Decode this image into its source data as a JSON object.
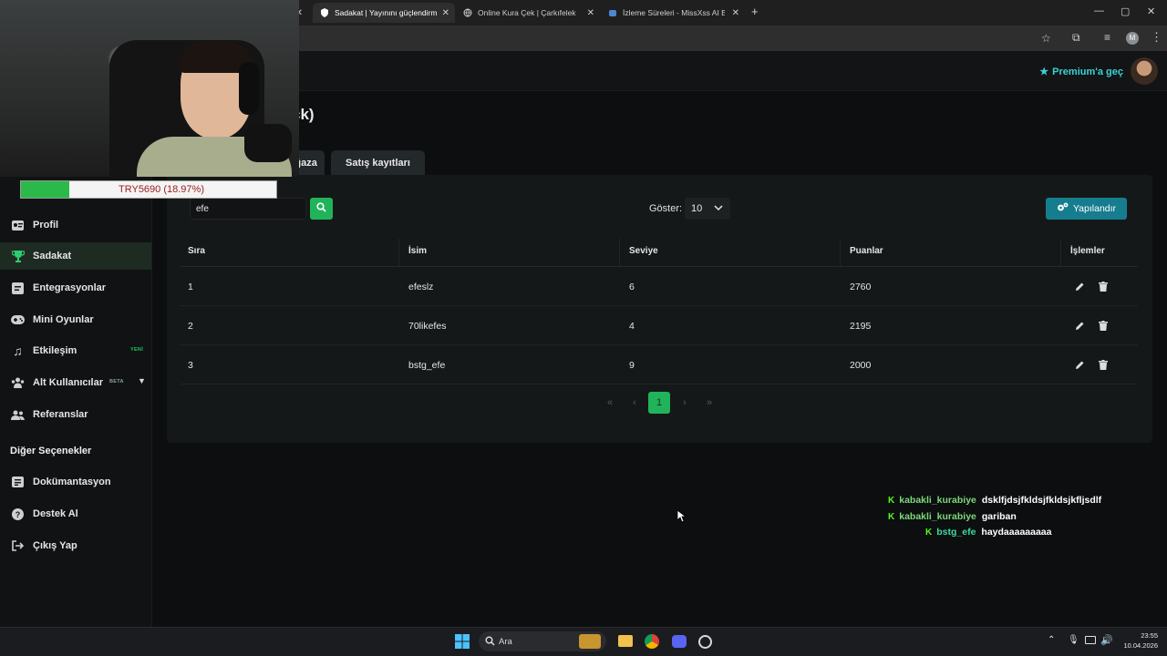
{
  "browser": {
    "tabs": [
      {
        "title": "Sadakat | Yayınını güçlendirmek",
        "active": true
      },
      {
        "title": "Online Kura Çek | Çarkıfelek",
        "active": false
      },
      {
        "title": "İzleme Süreleri - MissXss AI Bot",
        "active": false
      }
    ],
    "new_tab": "+",
    "profile_initial": "M"
  },
  "header": {
    "premium_label": "Premium'a geç"
  },
  "sidebar": {
    "items": [
      {
        "label": "Profil",
        "icon": "id-card-icon",
        "active": false
      },
      {
        "label": "Sadakat",
        "icon": "trophy-icon",
        "active": true
      },
      {
        "label": "Entegrasyonlar",
        "icon": "plugin-icon",
        "active": false
      },
      {
        "label": "Mini Oyunlar",
        "icon": "gamepad-icon",
        "active": false
      },
      {
        "label": "Etkileşim",
        "icon": "music-icon",
        "active": false,
        "badge": "YENİ",
        "badge_color": "#21c45d"
      },
      {
        "label": "Alt Kullanıcılar",
        "icon": "users-icon",
        "active": false,
        "badge": "BETA",
        "badge_color": "#8aa0a8"
      },
      {
        "label": "Referanslar",
        "icon": "handshake-icon",
        "active": false
      }
    ],
    "other_title": "Diğer Seçenekler",
    "other_items": [
      {
        "label": "Dokümantasyon",
        "icon": "doc-icon"
      },
      {
        "label": "Destek Al",
        "icon": "help-icon"
      },
      {
        "label": "Çıkış Yap",
        "icon": "logout-icon"
      }
    ]
  },
  "main": {
    "page_title_fragment": "ck)",
    "tabs": [
      {
        "label": "Mağaza"
      },
      {
        "label": "Satış kayıtları"
      }
    ],
    "search_value": "efe",
    "show_label": "Göster:",
    "show_value": "10",
    "configure_label": "Yapılandır",
    "table": {
      "headers": [
        "Sıra",
        "İsim",
        "Seviye",
        "Puanlar",
        "İşlemler"
      ],
      "rows": [
        {
          "rank": "1",
          "name": "efeslz",
          "level": "6",
          "points": "2760"
        },
        {
          "rank": "2",
          "name": "70likefes",
          "level": "4",
          "points": "2195"
        },
        {
          "rank": "3",
          "name": "bstg_efe",
          "level": "9",
          "points": "2000"
        }
      ]
    },
    "pagination": {
      "first": "«",
      "prev": "‹",
      "current": "1",
      "next": "›",
      "last": "»"
    }
  },
  "overlay": {
    "donation_progress": {
      "text": "TRY5690 (18.97%)",
      "percent": 18.97
    },
    "chat": [
      {
        "user": "kabakli_kurabiye",
        "message": "dsklfjdsjfkldsjfkldsjkfljsdlf"
      },
      {
        "user": "kabakli_kurabiye",
        "message": "gariban"
      },
      {
        "user": "bstg_efe",
        "message": "haydaaaaaaaaa"
      }
    ],
    "chat_badge": "K"
  },
  "taskbar": {
    "search_placeholder": "Ara",
    "time": "23:55",
    "date": "10.04.2026"
  }
}
